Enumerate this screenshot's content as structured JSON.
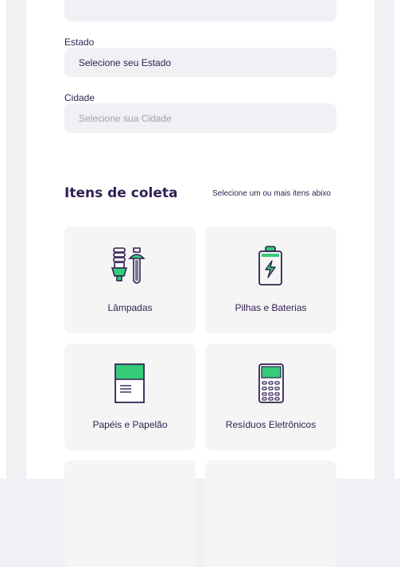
{
  "form": {
    "state_label": "Estado",
    "state_value": "Selecione seu Estado",
    "city_label": "Cidade",
    "city_placeholder": "Selecione sua Cidade"
  },
  "items_section": {
    "title": "Itens de coleta",
    "hint": "Selecione um ou mais itens abixo",
    "items": [
      {
        "label": "Lâmpadas",
        "icon": "lamps-icon"
      },
      {
        "label": "Pilhas e Baterias",
        "icon": "battery-icon"
      },
      {
        "label": "Papéis e Papelão",
        "icon": "paper-icon"
      },
      {
        "label": "Resíduos Eletrônicos",
        "icon": "electronics-icon"
      }
    ]
  },
  "colors": {
    "accent_green": "#34cb79",
    "dark_purple": "#322153",
    "input_bg": "#f0f0f5",
    "item_bg": "#f5f5f5"
  }
}
